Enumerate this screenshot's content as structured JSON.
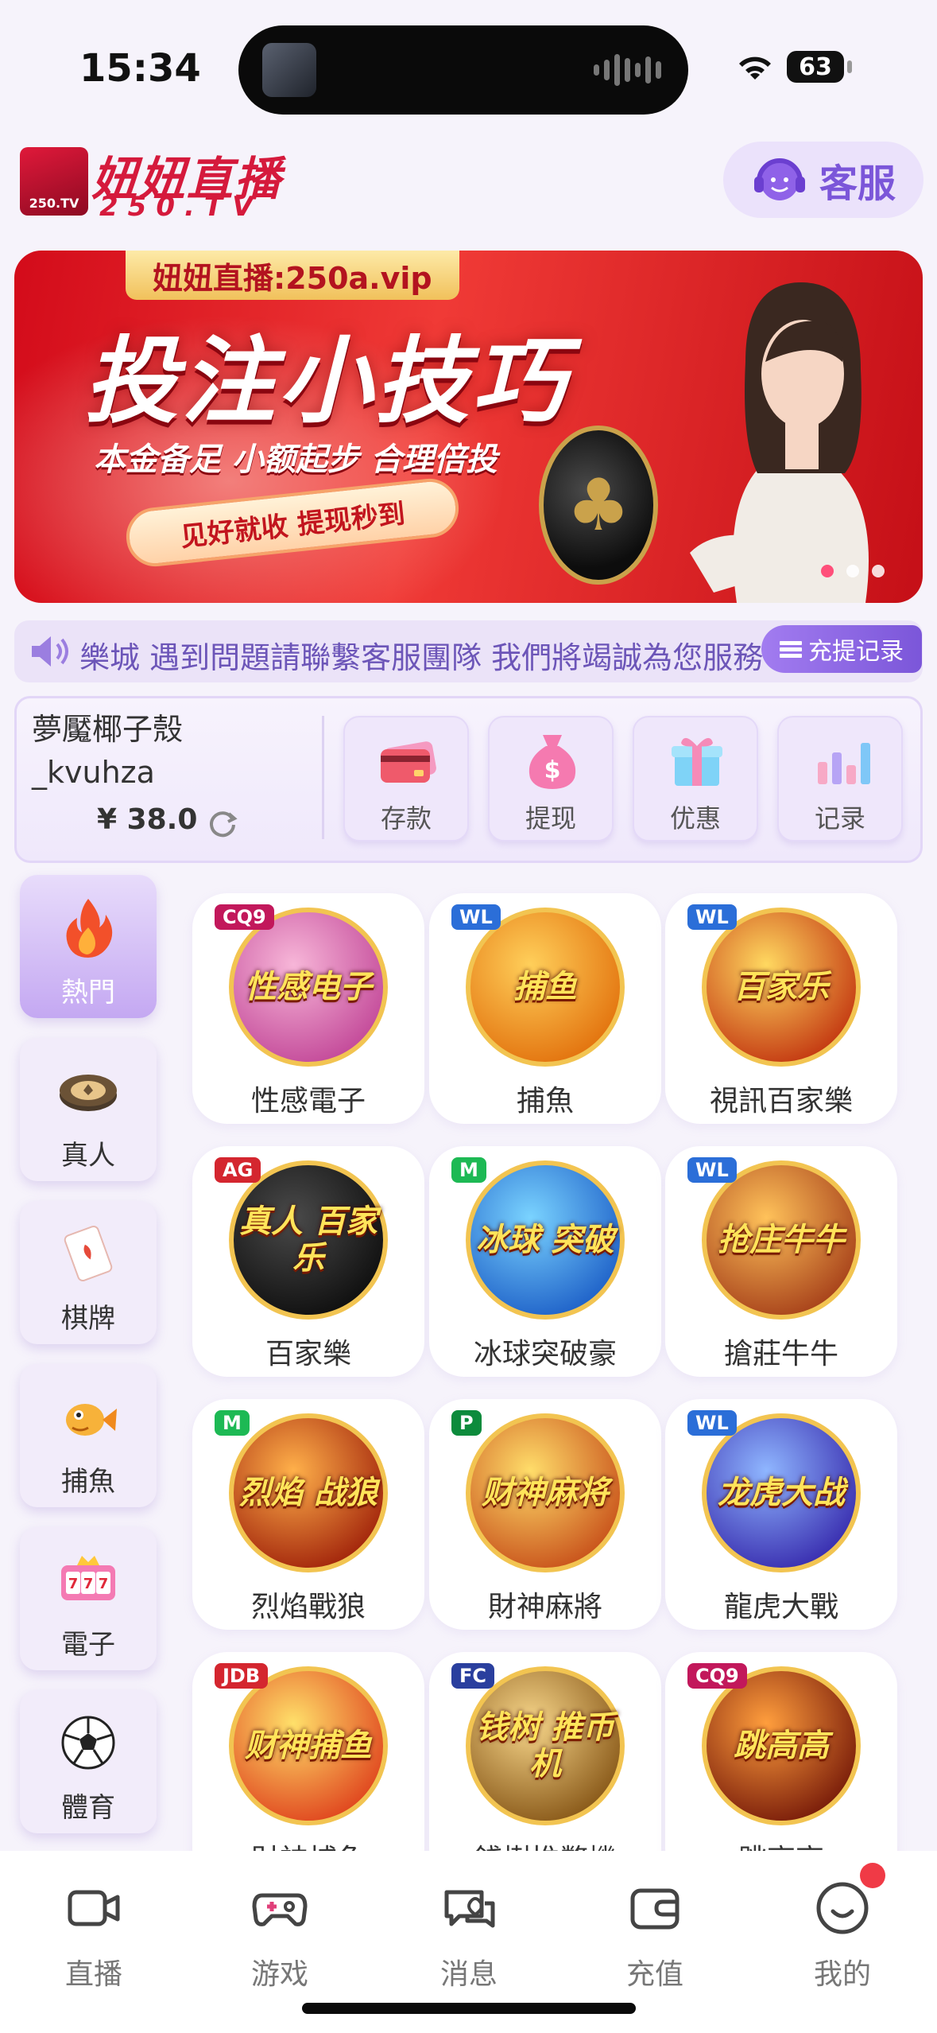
{
  "status_bar": {
    "time": "15:34",
    "battery": "63"
  },
  "header": {
    "logo_title": "妞妞直播",
    "logo_sub": "250.TV",
    "logo_badge": "250.TV",
    "service_label": "客服"
  },
  "banner": {
    "url": "妞妞直播:250a.vip",
    "title": "投注小技巧",
    "subtitle": "本金备足 小额起步 合理倍投",
    "pill": "见好就收 提现秒到",
    "dots": 3,
    "active_dot": 0
  },
  "marquee": {
    "text": "樂城 遇到問題請聯繫客服團隊 我們將竭誠為您服務",
    "record_label": "充提记录"
  },
  "user": {
    "name_line1": "夢魘椰子殼",
    "name_line2": "_kvuhza",
    "balance": "¥ 38.0"
  },
  "actions": [
    {
      "label": "存款",
      "icon": "card-icon"
    },
    {
      "label": "提现",
      "icon": "money-bag-icon"
    },
    {
      "label": "优惠",
      "icon": "gift-icon"
    },
    {
      "label": "记录",
      "icon": "bar-chart-icon"
    }
  ],
  "categories": [
    {
      "label": "熱門",
      "icon": "flame-icon",
      "active": true
    },
    {
      "label": "真人",
      "icon": "chip-icon",
      "active": false
    },
    {
      "label": "棋牌",
      "icon": "card-icon",
      "active": false
    },
    {
      "label": "捕魚",
      "icon": "fish-icon",
      "active": false
    },
    {
      "label": "電子",
      "icon": "slot-icon",
      "active": false
    },
    {
      "label": "體育",
      "icon": "soccer-ball-icon",
      "active": false
    }
  ],
  "games": [
    {
      "label": "性感電子",
      "art_text": "性感电子",
      "badge": "CQ9",
      "colors": [
        "#f7b6d8",
        "#c44b9a"
      ],
      "badge_color": "#c2185b"
    },
    {
      "label": "捕魚",
      "art_text": "捕鱼",
      "badge": "WL",
      "colors": [
        "#ffcf5a",
        "#e3740f"
      ],
      "badge_color": "#2b6ed8"
    },
    {
      "label": "視訊百家樂",
      "art_text": "百家乐",
      "badge": "WL",
      "colors": [
        "#ffd860",
        "#c43a12"
      ],
      "badge_color": "#2b6ed8"
    },
    {
      "label": "百家樂",
      "art_text": "真人 百家乐",
      "badge": "AG",
      "colors": [
        "#4a4a4a",
        "#101010"
      ],
      "badge_color": "#d4262f"
    },
    {
      "label": "冰球突破豪",
      "art_text": "冰球 突破",
      "badge": "M",
      "colors": [
        "#7ad3ff",
        "#2063c9"
      ],
      "badge_color": "#1db954"
    },
    {
      "label": "搶莊牛牛",
      "art_text": "抢庄牛牛",
      "badge": "WL",
      "colors": [
        "#ffc25a",
        "#a8431b"
      ],
      "badge_color": "#2b6ed8"
    },
    {
      "label": "烈焰戰狼",
      "art_text": "烈焰 战狼",
      "badge": "M",
      "colors": [
        "#ffb04a",
        "#a3260c"
      ],
      "badge_color": "#1db954"
    },
    {
      "label": "財神麻將",
      "art_text": "财神麻将",
      "badge": "P",
      "colors": [
        "#ffdd6a",
        "#c9541c"
      ],
      "badge_color": "#0d8b3c"
    },
    {
      "label": "龍虎大戰",
      "art_text": "龙虎大战",
      "badge": "WL",
      "colors": [
        "#8fb6ff",
        "#3a2fb0"
      ],
      "badge_color": "#2b6ed8"
    },
    {
      "label": "財神捕魚",
      "art_text": "财神捕鱼",
      "badge": "JDB",
      "colors": [
        "#ffe06a",
        "#e0471f"
      ],
      "badge_color": "#d4262f"
    },
    {
      "label": "錢樹推幣機",
      "art_text": "钱树 推币机",
      "badge": "FC",
      "colors": [
        "#f7d68a",
        "#8a5a1a"
      ],
      "badge_color": "#2a3f9e"
    },
    {
      "label": "跳高高",
      "art_text": "跳高高",
      "badge": "CQ9",
      "colors": [
        "#ff9e3d",
        "#7a1d0a"
      ],
      "badge_color": "#c2185b"
    }
  ],
  "tabs": [
    {
      "label": "直播",
      "icon": "camera-icon"
    },
    {
      "label": "游戏",
      "icon": "gamepad-icon"
    },
    {
      "label": "消息",
      "icon": "chat-icon"
    },
    {
      "label": "充值",
      "icon": "wallet-icon"
    },
    {
      "label": "我的",
      "icon": "smile-icon"
    }
  ]
}
